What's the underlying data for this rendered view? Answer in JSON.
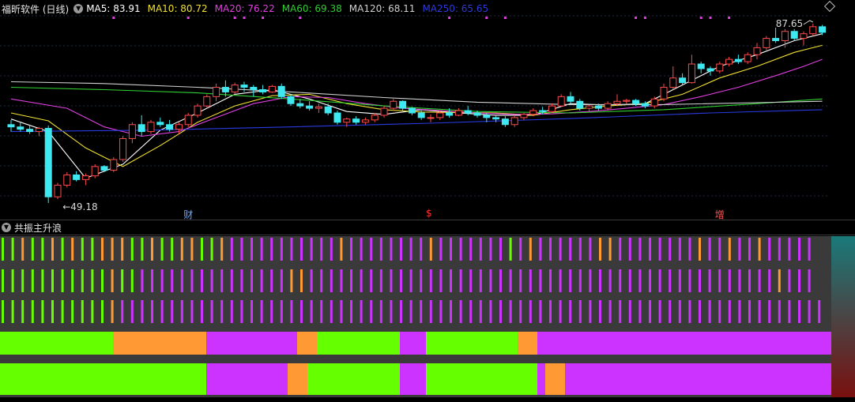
{
  "header": {
    "stock_title": "福昕软件 (日线)",
    "ma_items": [
      {
        "label": "MA5: 83.91",
        "color": "#ffffff"
      },
      {
        "label": "MA10: 80.72",
        "color": "#f0e030"
      },
      {
        "label": "MA20: 76.22",
        "color": "#e040e0"
      },
      {
        "label": "MA60: 69.38",
        "color": "#30d030"
      },
      {
        "label": "MA120: 68.11",
        "color": "#d0d0d0"
      },
      {
        "label": "MA250: 65.65",
        "color": "#2a3adf"
      }
    ],
    "collapse_icon": "chevron-down-icon",
    "settings_icon": "diamond-icon"
  },
  "chart_data": {
    "type": "candlestick",
    "low_label": "←49.18",
    "high_label": "87.65",
    "markers": [
      {
        "text": "财",
        "color": "#6fa8ff",
        "index": 19
      },
      {
        "text": "$",
        "color": "#ff3030",
        "index": 45
      },
      {
        "text": "增",
        "color": "#ff5555",
        "index": 76
      }
    ],
    "colors": {
      "up": "#ff4a4a",
      "down": "#3ee8f0"
    },
    "candles": [
      [
        66.0,
        67.0,
        64.5,
        65.5
      ],
      [
        65.5,
        66.5,
        64.5,
        65.0
      ],
      [
        65.0,
        66.0,
        64.0,
        64.5
      ],
      [
        64.5,
        65.5,
        63.5,
        65.2
      ],
      [
        65.2,
        65.8,
        49.18,
        50.5
      ],
      [
        50.5,
        53.5,
        50.0,
        53.0
      ],
      [
        53.0,
        55.8,
        52.5,
        55.2
      ],
      [
        55.2,
        56.0,
        53.8,
        54.2
      ],
      [
        54.2,
        55.5,
        53.0,
        55.0
      ],
      [
        55.0,
        57.5,
        54.5,
        57.0
      ],
      [
        57.0,
        57.3,
        55.8,
        56.2
      ],
      [
        56.2,
        59.0,
        55.8,
        58.5
      ],
      [
        58.5,
        63.5,
        58.0,
        63.0
      ],
      [
        63.0,
        66.5,
        62.0,
        66.0
      ],
      [
        66.0,
        68.0,
        63.5,
        64.5
      ],
      [
        64.5,
        67.0,
        64.0,
        66.5
      ],
      [
        66.5,
        67.5,
        65.5,
        66.0
      ],
      [
        66.0,
        67.0,
        64.5,
        65.0
      ],
      [
        65.0,
        66.5,
        64.0,
        66.0
      ],
      [
        66.0,
        68.5,
        65.5,
        68.0
      ],
      [
        68.0,
        70.5,
        67.5,
        70.0
      ],
      [
        70.0,
        72.5,
        69.5,
        72.0
      ],
      [
        72.0,
        74.8,
        71.0,
        74.0
      ],
      [
        74.0,
        75.5,
        72.0,
        73.0
      ],
      [
        73.0,
        75.0,
        72.5,
        74.5
      ],
      [
        74.5,
        75.2,
        73.0,
        74.0
      ],
      [
        74.0,
        74.5,
        72.0,
        73.5
      ],
      [
        73.5,
        74.5,
        72.5,
        73.0
      ],
      [
        73.0,
        74.5,
        72.8,
        74.2
      ],
      [
        74.2,
        74.8,
        71.5,
        72.0
      ],
      [
        72.0,
        72.5,
        70.0,
        70.5
      ],
      [
        70.5,
        71.5,
        69.5,
        70.0
      ],
      [
        70.0,
        71.0,
        69.0,
        69.5
      ],
      [
        69.5,
        70.5,
        68.5,
        69.8
      ],
      [
        69.8,
        70.5,
        68.0,
        68.5
      ],
      [
        68.5,
        69.0,
        66.0,
        66.5
      ],
      [
        66.5,
        67.5,
        65.5,
        67.2
      ],
      [
        67.2,
        67.8,
        66.0,
        66.5
      ],
      [
        66.5,
        67.5,
        66.0,
        67.0
      ],
      [
        67.0,
        68.5,
        66.5,
        68.0
      ],
      [
        68.0,
        70.0,
        67.5,
        69.5
      ],
      [
        69.5,
        71.5,
        69.0,
        71.0
      ],
      [
        71.0,
        71.2,
        69.0,
        69.5
      ],
      [
        69.5,
        69.8,
        68.0,
        68.5
      ],
      [
        68.5,
        69.0,
        67.0,
        67.5
      ],
      [
        67.5,
        68.2,
        66.5,
        67.5
      ],
      [
        67.5,
        69.0,
        67.0,
        68.5
      ],
      [
        68.5,
        69.5,
        67.5,
        68.0
      ],
      [
        68.0,
        69.5,
        67.8,
        69.0
      ],
      [
        69.0,
        70.0,
        68.0,
        68.5
      ],
      [
        68.5,
        69.0,
        67.5,
        68.0
      ],
      [
        68.0,
        68.5,
        66.5,
        67.5
      ],
      [
        67.5,
        68.0,
        66.5,
        67.2
      ],
      [
        67.2,
        67.8,
        65.5,
        66.0
      ],
      [
        66.0,
        68.0,
        65.5,
        67.5
      ],
      [
        67.5,
        68.5,
        67.0,
        68.2
      ],
      [
        68.2,
        69.5,
        67.8,
        69.0
      ],
      [
        69.0,
        69.8,
        68.2,
        68.8
      ],
      [
        68.8,
        70.5,
        68.5,
        70.0
      ],
      [
        70.0,
        72.5,
        69.8,
        72.0
      ],
      [
        72.0,
        73.0,
        70.5,
        71.0
      ],
      [
        71.0,
        71.5,
        69.0,
        69.5
      ],
      [
        69.5,
        70.2,
        68.8,
        70.0
      ],
      [
        70.0,
        70.5,
        69.0,
        69.5
      ],
      [
        69.5,
        71.0,
        69.0,
        70.5
      ],
      [
        70.5,
        72.5,
        70.0,
        71.0
      ],
      [
        71.0,
        71.5,
        70.5,
        71.2
      ],
      [
        71.2,
        71.5,
        70.0,
        70.5
      ],
      [
        70.5,
        71.0,
        69.5,
        70.0
      ],
      [
        70.0,
        72.0,
        69.5,
        71.5
      ],
      [
        71.5,
        74.8,
        71.0,
        74.0
      ],
      [
        74.0,
        78.5,
        73.5,
        76.0
      ],
      [
        76.0,
        77.0,
        74.5,
        75.0
      ],
      [
        75.0,
        81.0,
        74.8,
        79.0
      ],
      [
        79.0,
        79.5,
        77.0,
        78.0
      ],
      [
        78.0,
        78.5,
        76.5,
        77.5
      ],
      [
        77.5,
        79.5,
        77.0,
        79.0
      ],
      [
        79.0,
        80.5,
        78.5,
        80.0
      ],
      [
        80.0,
        81.0,
        79.0,
        79.5
      ],
      [
        79.5,
        81.5,
        79.0,
        81.0
      ],
      [
        81.0,
        83.5,
        80.0,
        82.5
      ],
      [
        82.5,
        85.0,
        82.0,
        84.5
      ],
      [
        84.5,
        86.8,
        83.5,
        84.0
      ],
      [
        84.0,
        86.5,
        82.5,
        86.0
      ],
      [
        86.0,
        86.5,
        84.0,
        84.5
      ],
      [
        84.5,
        86.0,
        83.0,
        85.5
      ],
      [
        85.5,
        87.65,
        85.0,
        87.0
      ],
      [
        87.0,
        87.4,
        85.2,
        85.8
      ]
    ],
    "ma_series": [
      {
        "name": "MA5",
        "values": [
          [
            0,
            67.2
          ],
          [
            4,
            64.5
          ],
          [
            8,
            54.5
          ],
          [
            12,
            57.5
          ],
          [
            16,
            64.8
          ],
          [
            20,
            68.5
          ],
          [
            24,
            72.5
          ],
          [
            28,
            73.5
          ],
          [
            32,
            71.5
          ],
          [
            36,
            68.8
          ],
          [
            40,
            68.2
          ],
          [
            44,
            69.2
          ],
          [
            48,
            68.5
          ],
          [
            52,
            68.0
          ],
          [
            56,
            68.0
          ],
          [
            60,
            70.5
          ],
          [
            64,
            70.2
          ],
          [
            68,
            70.5
          ],
          [
            72,
            74.5
          ],
          [
            76,
            78.5
          ],
          [
            80,
            81.0
          ],
          [
            84,
            84.0
          ],
          [
            87,
            85.5
          ]
        ]
      },
      {
        "name": "MA10",
        "values": [
          [
            0,
            68.5
          ],
          [
            4,
            66.8
          ],
          [
            8,
            61.0
          ],
          [
            12,
            57.0
          ],
          [
            16,
            61.5
          ],
          [
            20,
            66.5
          ],
          [
            24,
            70.0
          ],
          [
            28,
            72.2
          ],
          [
            32,
            72.5
          ],
          [
            36,
            70.5
          ],
          [
            40,
            69.2
          ],
          [
            44,
            68.7
          ],
          [
            48,
            68.6
          ],
          [
            52,
            68.5
          ],
          [
            56,
            68.0
          ],
          [
            60,
            69.2
          ],
          [
            64,
            70.0
          ],
          [
            68,
            70.5
          ],
          [
            72,
            72.5
          ],
          [
            76,
            76.0
          ],
          [
            80,
            78.5
          ],
          [
            84,
            81.5
          ],
          [
            87,
            83.0
          ]
        ]
      },
      {
        "name": "MA20",
        "values": [
          [
            0,
            71.5
          ],
          [
            6,
            69.5
          ],
          [
            10,
            65.5
          ],
          [
            14,
            63.5
          ],
          [
            18,
            64.5
          ],
          [
            22,
            67.5
          ],
          [
            26,
            70.5
          ],
          [
            30,
            72.0
          ],
          [
            34,
            71.8
          ],
          [
            38,
            70.5
          ],
          [
            42,
            69.5
          ],
          [
            46,
            69.0
          ],
          [
            50,
            68.5
          ],
          [
            54,
            68.2
          ],
          [
            58,
            68.3
          ],
          [
            62,
            68.8
          ],
          [
            66,
            69.5
          ],
          [
            70,
            70.3
          ],
          [
            74,
            72.0
          ],
          [
            78,
            74.0
          ],
          [
            82,
            76.5
          ],
          [
            85,
            78.5
          ],
          [
            87,
            80.0
          ]
        ]
      },
      {
        "name": "MA60",
        "values": [
          [
            0,
            74.0
          ],
          [
            10,
            73.5
          ],
          [
            20,
            72.8
          ],
          [
            30,
            71.5
          ],
          [
            40,
            70.0
          ],
          [
            50,
            68.8
          ],
          [
            60,
            68.5
          ],
          [
            70,
            69.2
          ],
          [
            80,
            70.5
          ],
          [
            87,
            71.5
          ]
        ]
      },
      {
        "name": "MA120",
        "values": [
          [
            0,
            75.2
          ],
          [
            10,
            74.8
          ],
          [
            20,
            74.0
          ],
          [
            30,
            73.0
          ],
          [
            40,
            71.8
          ],
          [
            50,
            70.8
          ],
          [
            60,
            70.3
          ],
          [
            70,
            70.3
          ],
          [
            80,
            70.7
          ],
          [
            87,
            71.0
          ]
        ]
      },
      {
        "name": "MA250",
        "values": [
          [
            0,
            64.5
          ],
          [
            15,
            64.8
          ],
          [
            30,
            65.5
          ],
          [
            45,
            66.3
          ],
          [
            60,
            67.3
          ],
          [
            75,
            68.5
          ],
          [
            87,
            69.2
          ]
        ]
      }
    ],
    "signal_dots": {
      "color": "#e040e0",
      "indices": [
        11,
        19,
        24,
        25,
        27,
        31,
        47,
        51,
        53,
        67,
        68,
        74,
        75,
        77
      ]
    }
  },
  "indicator": {
    "title": "共振主升浪",
    "bar_colors": {
      "g": "#66ff00",
      "o": "#ff9933",
      "p": "#cc33ff"
    },
    "rows": [
      "ggoggogoggoooggoggooggopppppppppppoppppppppopppppppgpoppppppooppppppppoppoppoppppp",
      "gggggggggggoggpppppppppppppppoopppppppppppppppppppppppppppppppppppppppppppppppoppp",
      "gggggggggggoppppppppppppppppppppppppppppppppppppppppppppppppppppppppppppppppppppppp"
    ],
    "band1": [
      {
        "c": "g",
        "from": 0,
        "to": 143
      },
      {
        "c": "o",
        "from": 143,
        "to": 261
      },
      {
        "c": "p",
        "from": 261,
        "to": 376
      },
      {
        "c": "o",
        "from": 376,
        "to": 401
      },
      {
        "c": "g",
        "from": 401,
        "to": 506
      },
      {
        "c": "p",
        "from": 506,
        "to": 539
      },
      {
        "c": "g",
        "from": 539,
        "to": 655
      },
      {
        "c": "o",
        "from": 655,
        "to": 680
      },
      {
        "c": "p",
        "from": 680,
        "to": 1052
      }
    ],
    "band2": [
      {
        "c": "g",
        "from": 0,
        "to": 261
      },
      {
        "c": "p",
        "from": 261,
        "to": 364
      },
      {
        "c": "o",
        "from": 364,
        "to": 389
      },
      {
        "c": "g",
        "from": 389,
        "to": 506
      },
      {
        "c": "p",
        "from": 506,
        "to": 539
      },
      {
        "c": "g",
        "from": 539,
        "to": 680
      },
      {
        "c": "p",
        "from": 680,
        "to": 690
      },
      {
        "c": "o",
        "from": 690,
        "to": 715
      },
      {
        "c": "p",
        "from": 715,
        "to": 1052
      }
    ]
  }
}
